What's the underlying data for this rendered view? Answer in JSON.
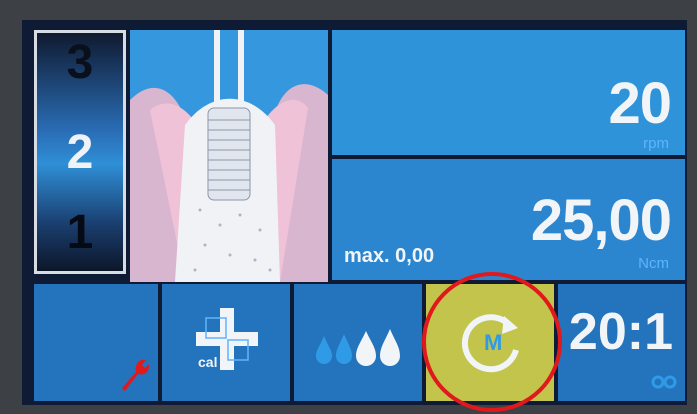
{
  "program_selector": {
    "items": [
      "3",
      "2",
      "1"
    ],
    "active": "1"
  },
  "speed": {
    "value": "20",
    "unit": "rpm"
  },
  "torque": {
    "value": "25,00",
    "unit": "Ncm",
    "max_label": "max. 0,00"
  },
  "buttons": {
    "settings": {
      "icon": "wrench-icon"
    },
    "calibrate": {
      "label": "cal",
      "icon": "crosshair-plus-icon"
    },
    "irrigation": {
      "icon": "water-drops-icon",
      "level": 2,
      "max_level": 4
    },
    "motor_mode": {
      "label": "M",
      "icon": "rotate-cycle-icon",
      "active": true
    },
    "gear_ratio": {
      "label": "20:1",
      "icon": "gear-link-icon"
    }
  },
  "colors": {
    "panel_blue": "#2f8fd6",
    "accent_red": "#e0191d",
    "active_yellow": "#c3c44c"
  }
}
